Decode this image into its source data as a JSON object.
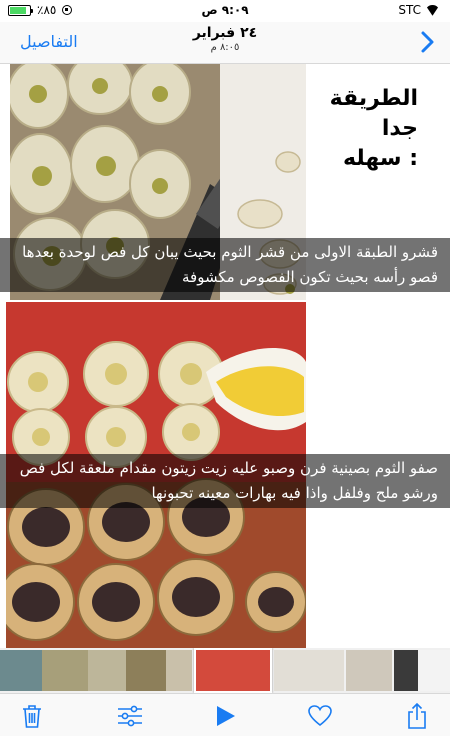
{
  "status_bar": {
    "battery_percent": "٪٨٥",
    "battery_level": 0.85,
    "time": "٩:٠٩ ص",
    "carrier": "STC"
  },
  "nav": {
    "details_label": "التفاصيل",
    "date": "٢٤ فبراير",
    "time": "٨:٠٥ م"
  },
  "content": {
    "heading_lines": [
      "الطريقة",
      "جدا",
      "سهله :"
    ],
    "captions": [
      "قشرو الطبقة الاولى من قشر الثوم بحيث يبان كل فص لوحدة بعدها قصو رأسه بحيث تكون الفصوص مكشوفة",
      "صفو الثوم بصينية فرن وصبو عليه زيت زيتون مقدام ملعقة لكل فص ورشو ملح وفلفل واذا فيه بهارات معينه تحبونها"
    ]
  },
  "toolbar": {
    "icons": [
      "trash-icon",
      "adjust-icon",
      "play-icon",
      "heart-icon",
      "share-icon"
    ]
  },
  "colors": {
    "accent": "#1a7cf2"
  }
}
